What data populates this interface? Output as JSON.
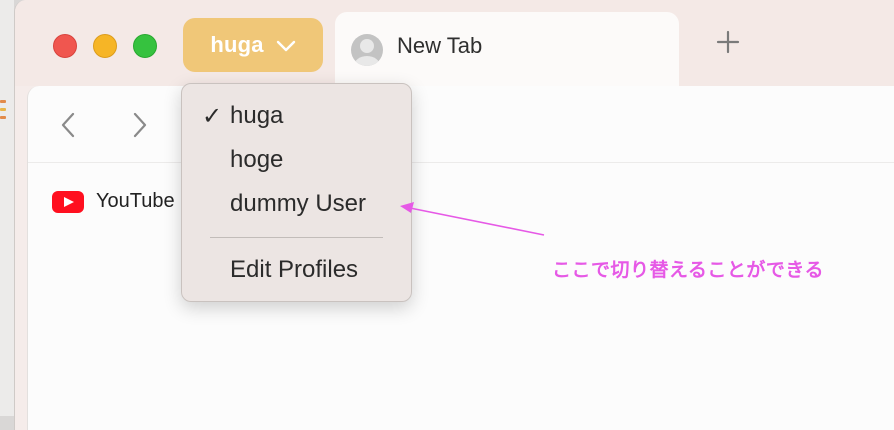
{
  "window": {
    "profile_button": {
      "label": "huga",
      "color": "#f0c778"
    },
    "tab": {
      "title": "New Tab"
    },
    "new_tab_symbol": "+"
  },
  "bookmarks": [
    {
      "label": "YouTube",
      "icon": "youtube-icon"
    }
  ],
  "profile_menu": {
    "items": [
      {
        "label": "huga",
        "checked": true,
        "check_mark": "✓"
      },
      {
        "label": "hoge",
        "checked": false
      },
      {
        "label": "dummy User",
        "checked": false
      }
    ],
    "edit_label": "Edit Profiles"
  },
  "annotation": {
    "text": "ここで切り替えることができる",
    "color": "#e659e6"
  }
}
